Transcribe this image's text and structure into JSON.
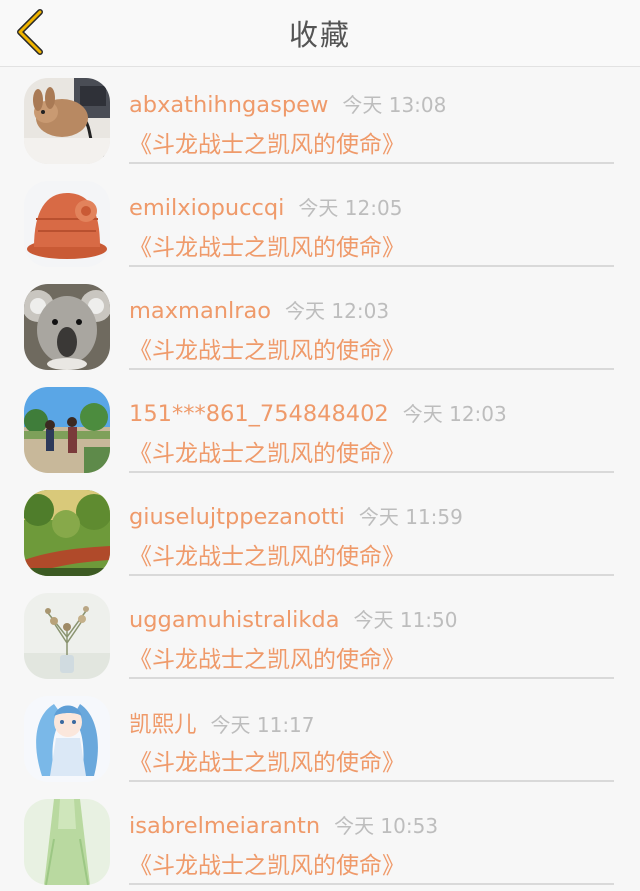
{
  "header": {
    "title": "收藏",
    "back_icon": "chevron-left-icon",
    "accent_color": "#f0b400"
  },
  "text_color": "#ef9a6a",
  "items": [
    {
      "username": "abxathihngaspew",
      "time": "今天 13:08",
      "book": "《斗龙战士之凯风的使命》",
      "avatar": "rabbit-avatar"
    },
    {
      "username": "emilxiopuccqi",
      "time": "今天 12:05",
      "book": "《斗龙战士之凯风的使命》",
      "avatar": "knit-hat-avatar"
    },
    {
      "username": "maxmanlrao",
      "time": "今天 12:03",
      "book": "《斗龙战士之凯风的使命》",
      "avatar": "koala-avatar"
    },
    {
      "username": "151***861_754848402",
      "time": "今天 12:03",
      "book": "《斗龙战士之凯风的使命》",
      "avatar": "park-photo-avatar"
    },
    {
      "username": "giuselujtppezanotti",
      "time": "今天 11:59",
      "book": "《斗龙战士之凯风的使命》",
      "avatar": "forest-path-avatar"
    },
    {
      "username": "uggamuhistralikda",
      "time": "今天 11:50",
      "book": "《斗龙战士之凯风的使命》",
      "avatar": "flower-vase-avatar"
    },
    {
      "username": "凯熙儿",
      "time": "今天 11:17",
      "book": "《斗龙战士之凯风的使命》",
      "avatar": "anime-girl-avatar"
    },
    {
      "username": "isabrelmeiarantn",
      "time": "今天 10:53",
      "book": "《斗龙战士之凯风的使命》",
      "avatar": "green-dress-avatar"
    }
  ]
}
